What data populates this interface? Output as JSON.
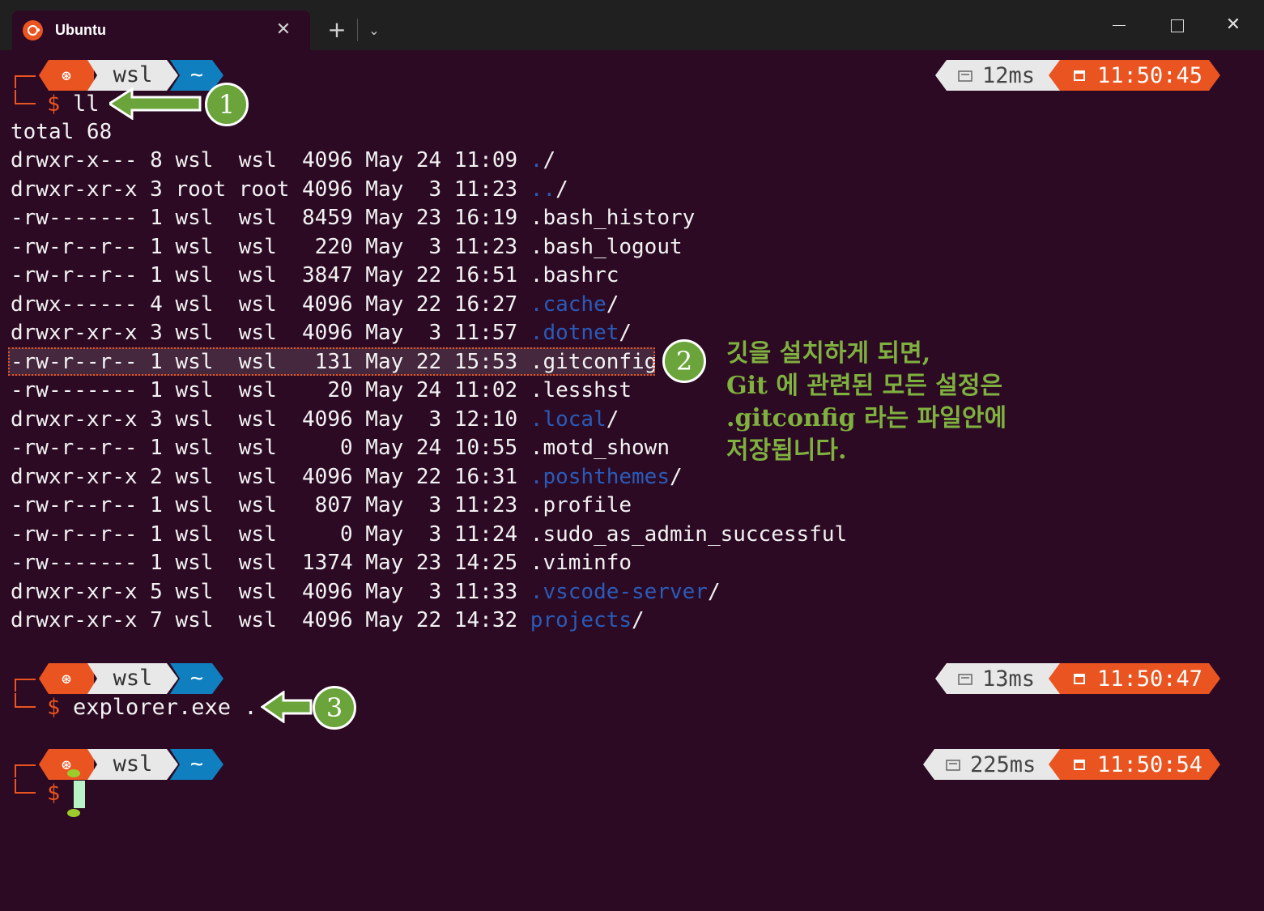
{
  "window": {
    "tab_title": "Ubuntu",
    "tab_close": "✕",
    "new_tab": "+",
    "dropdown": "⌄",
    "minimize": "",
    "maximize": "",
    "close": "✕"
  },
  "prompt": {
    "user": "wsl",
    "path": "~",
    "dollar": "$"
  },
  "blocks": [
    {
      "command": "ll",
      "duration": "12ms",
      "clock": "11:50:45"
    },
    {
      "command": "explorer.exe .",
      "duration": "13ms",
      "clock": "11:50:47"
    },
    {
      "command": "",
      "duration": "225ms",
      "clock": "11:50:54"
    }
  ],
  "listing": {
    "total": "total 68",
    "rows": [
      {
        "meta": "drwxr-x--- 8 wsl  wsl  4096 May 24 11:09 ",
        "name": ".",
        "suffix": "/",
        "is_dir": true
      },
      {
        "meta": "drwxr-xr-x 3 root root 4096 May  3 11:23 ",
        "name": "..",
        "suffix": "/",
        "is_dir": true
      },
      {
        "meta": "-rw------- 1 wsl  wsl  8459 May 23 16:19 ",
        "name": ".bash_history",
        "suffix": "",
        "is_dir": false
      },
      {
        "meta": "-rw-r--r-- 1 wsl  wsl   220 May  3 11:23 ",
        "name": ".bash_logout",
        "suffix": "",
        "is_dir": false
      },
      {
        "meta": "-rw-r--r-- 1 wsl  wsl  3847 May 22 16:51 ",
        "name": ".bashrc",
        "suffix": "",
        "is_dir": false
      },
      {
        "meta": "drwx------ 4 wsl  wsl  4096 May 22 16:27 ",
        "name": ".cache",
        "suffix": "/",
        "is_dir": true
      },
      {
        "meta": "drwxr-xr-x 3 wsl  wsl  4096 May  3 11:57 ",
        "name": ".dotnet",
        "suffix": "/",
        "is_dir": true
      },
      {
        "meta": "-rw-r--r-- 1 wsl  wsl   131 May 22 15:53 ",
        "name": ".gitconfig",
        "suffix": "",
        "is_dir": false
      },
      {
        "meta": "-rw------- 1 wsl  wsl    20 May 24 11:02 ",
        "name": ".lesshst",
        "suffix": "",
        "is_dir": false
      },
      {
        "meta": "drwxr-xr-x 3 wsl  wsl  4096 May  3 12:10 ",
        "name": ".local",
        "suffix": "/",
        "is_dir": true
      },
      {
        "meta": "-rw-r--r-- 1 wsl  wsl     0 May 24 10:55 ",
        "name": ".motd_shown",
        "suffix": "",
        "is_dir": false
      },
      {
        "meta": "drwxr-xr-x 2 wsl  wsl  4096 May 22 16:31 ",
        "name": ".poshthemes",
        "suffix": "/",
        "is_dir": true
      },
      {
        "meta": "-rw-r--r-- 1 wsl  wsl   807 May  3 11:23 ",
        "name": ".profile",
        "suffix": "",
        "is_dir": false
      },
      {
        "meta": "-rw-r--r-- 1 wsl  wsl     0 May  3 11:24 ",
        "name": ".sudo_as_admin_successful",
        "suffix": "",
        "is_dir": false
      },
      {
        "meta": "-rw------- 1 wsl  wsl  1374 May 23 14:25 ",
        "name": ".viminfo",
        "suffix": "",
        "is_dir": false
      },
      {
        "meta": "drwxr-xr-x 5 wsl  wsl  4096 May  3 11:33 ",
        "name": ".vscode-server",
        "suffix": "/",
        "is_dir": true
      },
      {
        "meta": "drwxr-xr-x 7 wsl  wsl  4096 May 22 14:32 ",
        "name": "projects",
        "suffix": "/",
        "is_dir": true
      }
    ]
  },
  "annotations": {
    "badge1": "1",
    "badge2": "2",
    "badge3": "3",
    "note": "깃을 설치하게 되면,\nGit 에 관련된 모든 설정은\n.gitconfig 라는 파일안에\n저장됩니다."
  },
  "colors": {
    "background": "#2c0a24",
    "accent": "#e95420",
    "directory": "#2a5bb8",
    "path_segment": "#0f7fbf",
    "annotation": "#6aa43a"
  }
}
